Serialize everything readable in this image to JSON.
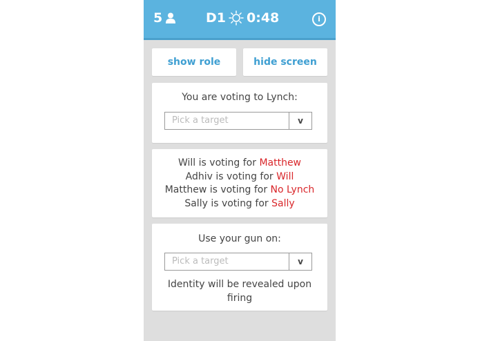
{
  "header": {
    "player_count": "5",
    "day": "D1",
    "timer": "0:48",
    "info_label": "i",
    "bar_color": "#5bb3df"
  },
  "actions": {
    "show_role": "show role",
    "hide_screen": "hide screen"
  },
  "lynch_panel": {
    "title": "You are voting to Lynch:",
    "select_placeholder": "Pick a target",
    "select_caret": "v"
  },
  "votes": [
    {
      "voter": "Will",
      "text": " is voting for ",
      "target": "Matthew"
    },
    {
      "voter": "Adhiv",
      "text": " is voting for ",
      "target": "Will"
    },
    {
      "voter": "Matthew",
      "text": " is voting for ",
      "target": "No Lynch"
    },
    {
      "voter": "Sally",
      "text": " is voting for ",
      "target": "Sally"
    }
  ],
  "gun_panel": {
    "title": "Use your gun on:",
    "select_placeholder": "Pick a target",
    "select_caret": "v",
    "note": "Identity will be revealed upon firing"
  },
  "colors": {
    "accent": "#3f9fd2",
    "vote_target": "#d9262a",
    "background": "#dedede"
  }
}
